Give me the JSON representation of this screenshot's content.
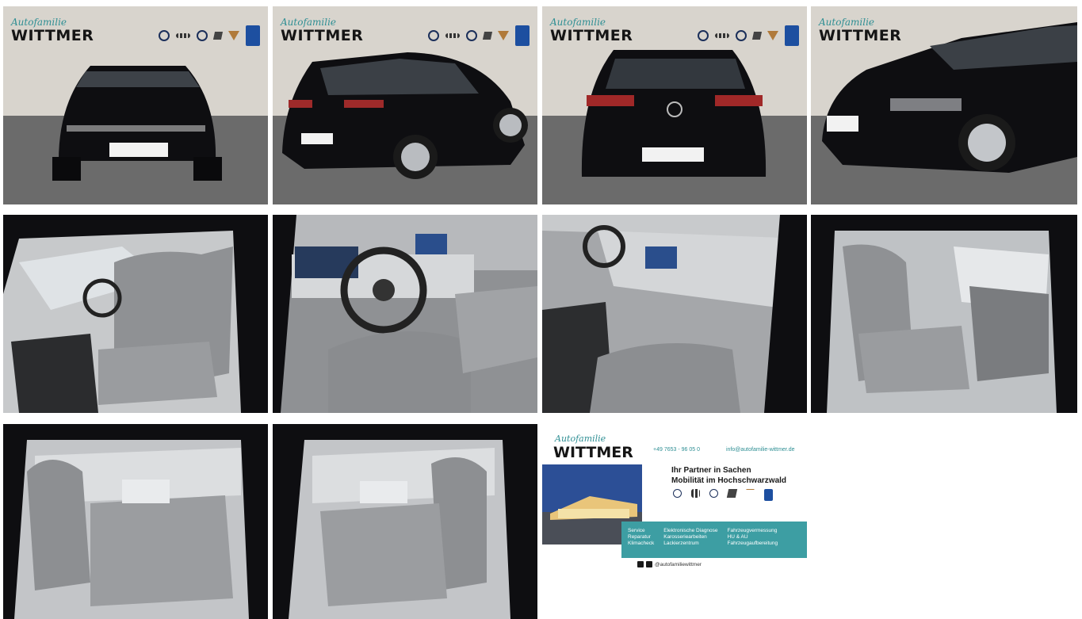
{
  "brand": {
    "small": "Autofamilie",
    "big": "WITTMER"
  },
  "card": {
    "phone": "+49 7653 - 96 05 0",
    "email": "info@autofamilie-wittmer.de",
    "headline1": "Ihr Partner in Sachen",
    "headline2": "Mobilität im Hochschwarzwald",
    "services_col1": [
      "Service",
      "Reparatur",
      "Klimacheck"
    ],
    "services_col2": [
      "Elektronische Diagnose",
      "Karosseriearbeiten",
      "Lackierzentrum"
    ],
    "services_col3": [
      "Fahrzeugvermessung",
      "HU & AU",
      "Fahrzeugaufbereitung"
    ],
    "social": "@autofamiliewittmer"
  },
  "colors": {
    "teal": "#3d9ea3",
    "car_black": "#0d0d10",
    "wall": "#d7d3cc",
    "floor": "#6a6a6a",
    "interior_grey": "#8d8f92"
  }
}
